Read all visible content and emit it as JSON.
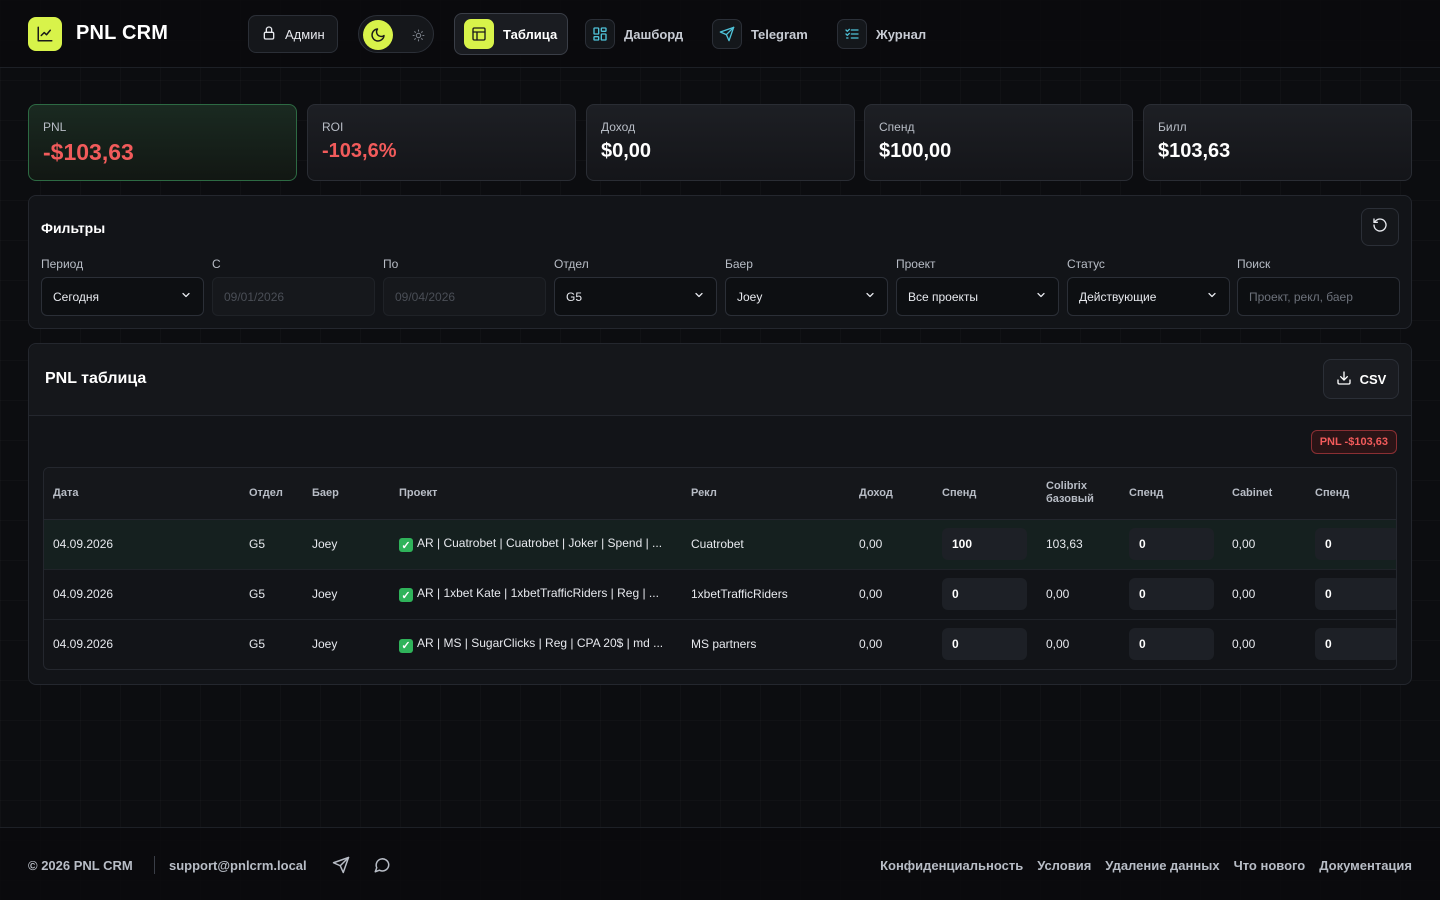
{
  "header": {
    "brand": "PNL CRM",
    "admin_label": "Админ",
    "nav": [
      {
        "label": "Таблица",
        "icon": "table-icon",
        "active": true
      },
      {
        "label": "Дашборд",
        "icon": "dashboard-icon",
        "active": false
      },
      {
        "label": "Telegram",
        "icon": "telegram-icon",
        "active": false
      },
      {
        "label": "Журнал",
        "icon": "journal-icon",
        "active": false
      }
    ]
  },
  "stats": [
    {
      "label": "PNL",
      "value": "-$103,63"
    },
    {
      "label": "ROI",
      "value": "-103,6%"
    },
    {
      "label": "Доход",
      "value": "$0,00"
    },
    {
      "label": "Спенд",
      "value": "$100,00"
    },
    {
      "label": "Билл",
      "value": "$103,63"
    }
  ],
  "filters": {
    "title": "Фильтры",
    "fields": [
      {
        "label": "Период",
        "value": "Сегодня"
      },
      {
        "label": "С",
        "value": "09/01/2026"
      },
      {
        "label": "По",
        "value": "09/04/2026"
      },
      {
        "label": "Отдел",
        "value": "G5"
      },
      {
        "label": "Баер",
        "value": "Joey"
      },
      {
        "label": "Проект",
        "value": "Все проекты"
      },
      {
        "label": "Статус",
        "value": "Действующие"
      },
      {
        "label": "Поиск",
        "placeholder": "Проект, рекл, баер"
      }
    ]
  },
  "table": {
    "title": "PNL таблица",
    "csv_label": "CSV",
    "pnl_badge": "PNL -$103,63",
    "columns": [
      "Дата",
      "Отдел",
      "Баер",
      "Проект",
      "Рекл",
      "Доход",
      "Спенд",
      "Colibrix базовый",
      "Спенд",
      "Cabinet",
      "Спенд"
    ],
    "rows": [
      {
        "date": "04.09.2026",
        "dept": "G5",
        "buyer": "Joey",
        "project": "AR | Cuatrobet | Cuatrobet | Joker | Spend | ...",
        "adv": "Cuatrobet",
        "income": "0,00",
        "spend1": "100",
        "colibrix": "103,63",
        "spend2": "0",
        "cabinet": "0,00",
        "spend3": "0"
      },
      {
        "date": "04.09.2026",
        "dept": "G5",
        "buyer": "Joey",
        "project": "AR | 1xbet Kate | 1xbetTrafficRiders | Reg | ...",
        "adv": "1xbetTrafficRiders",
        "income": "0,00",
        "spend1": "0",
        "colibrix": "0,00",
        "spend2": "0",
        "cabinet": "0,00",
        "spend3": "0"
      },
      {
        "date": "04.09.2026",
        "dept": "G5",
        "buyer": "Joey",
        "project": "AR | MS | SugarClicks | Reg | CPA 20$ | md ...",
        "adv": "MS partners",
        "income": "0,00",
        "spend1": "0",
        "colibrix": "0,00",
        "spend2": "0",
        "cabinet": "0,00",
        "spend3": "0"
      }
    ]
  },
  "footer": {
    "copyright": "© 2026 PNL CRM",
    "email": "support@pnlcrm.local",
    "links": [
      "Конфиденциальность",
      "Условия",
      "Удаление данных",
      "Что нового",
      "Документация"
    ]
  },
  "colors": {
    "accent": "#d8f34a",
    "negative": "#f25b5b",
    "positive_border": "#2d6a43"
  }
}
